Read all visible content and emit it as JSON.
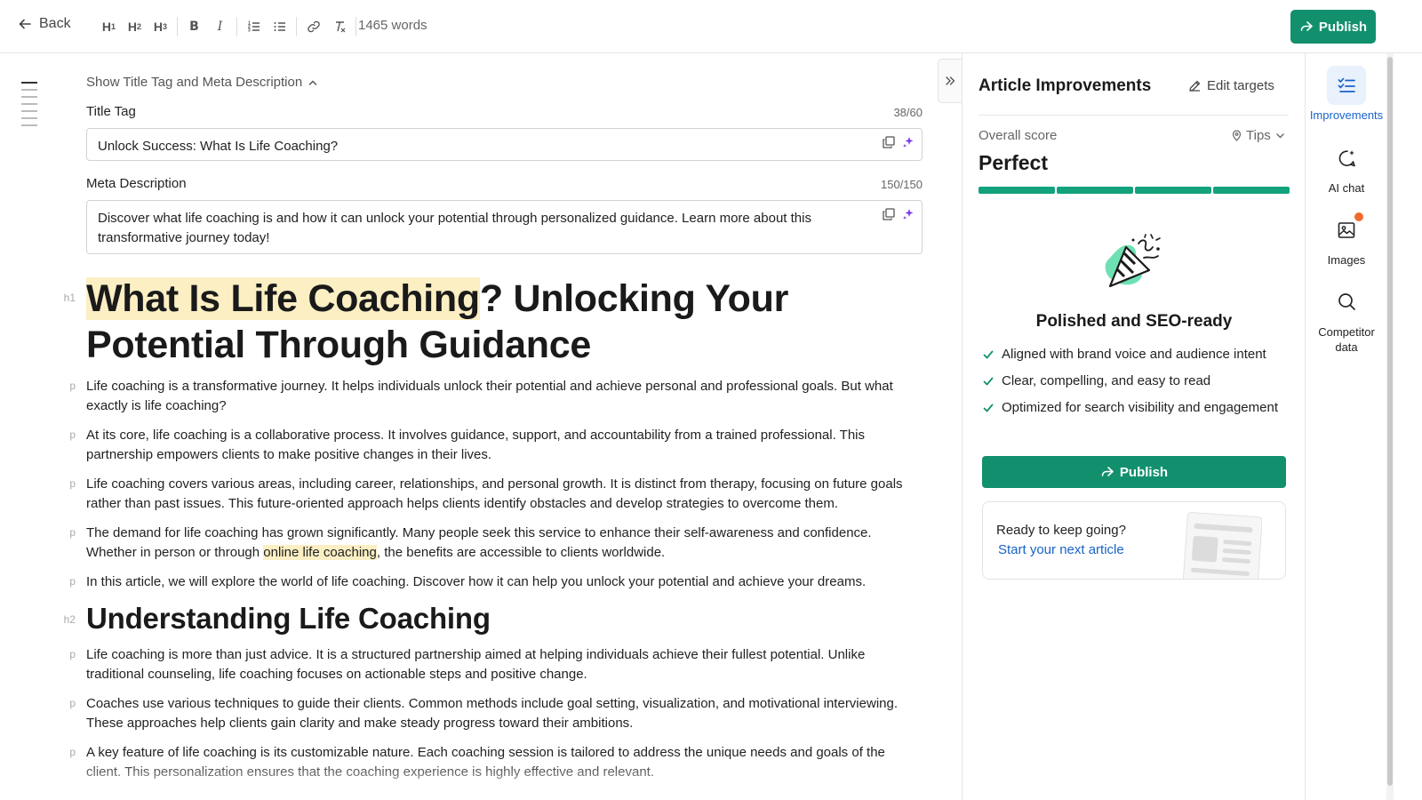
{
  "toolbar": {
    "back_label": "Back",
    "word_count": "1465 words",
    "publish_label": "Publish",
    "tools": [
      "H1",
      "H2",
      "H3",
      "bold",
      "italic",
      "ordered-list",
      "bullet-list",
      "link",
      "clear-format"
    ]
  },
  "meta": {
    "toggle_label": "Show Title Tag and Meta Description",
    "title_label": "Title Tag",
    "title_count": "38/60",
    "title_value": "Unlock Success: What Is Life Coaching?",
    "desc_label": "Meta Description",
    "desc_count": "150/150",
    "desc_value": "Discover what life coaching is and how it can unlock your potential through personalized guidance. Learn more about this transformative journey today!"
  },
  "article": {
    "h1_highlight": "What Is Life Coaching",
    "h1_rest": "? Unlocking Your Potential Through Guidance",
    "p1": "Life coaching is a transformative journey. It helps individuals unlock their potential and achieve personal and professional goals. But what exactly is life coaching?",
    "p2": "At its core, life coaching is a collaborative process. It involves guidance, support, and accountability from a trained professional. This partnership empowers clients to make positive changes in their lives.",
    "p3": "Life coaching covers various areas, including career, relationships, and personal growth. It is distinct from therapy, focusing on future goals rather than past issues. This future-oriented approach helps clients identify obstacles and develop strategies to overcome them.",
    "p4_before": "The demand for life coaching has grown significantly. Many people seek this service to enhance their self-awareness and confidence. Whether in person or through ",
    "p4_highlight": "online life coaching",
    "p4_after": ", the benefits are accessible to clients worldwide.",
    "p5": "In this article, we will explore the world of life coaching. Discover how it can help you unlock your potential and achieve your dreams.",
    "h2": "Understanding Life Coaching",
    "p6": "Life coaching is more than just advice. It is a structured partnership aimed at helping individuals achieve their fullest potential. Unlike traditional counseling, life coaching focuses on actionable steps and positive change.",
    "p7": "Coaches use various techniques to guide their clients. Common methods include goal setting, visualization, and motivational interviewing. These approaches help clients gain clarity and make steady progress toward their ambitions.",
    "p8": "A key feature of life coaching is its customizable nature. Each coaching session is tailored to address the unique needs and goals of the client. This personalization ensures that the coaching experience is highly effective and relevant.",
    "tag_h1": "h1",
    "tag_h2": "h2",
    "tag_p": "p"
  },
  "panel": {
    "title": "Article Improvements",
    "edit_targets": "Edit targets",
    "score_label": "Overall score",
    "tips_label": "Tips",
    "score_value": "Perfect",
    "score_segments_filled": 4,
    "score_segments_total": 4,
    "result_title": "Polished and SEO-ready",
    "checks": [
      "Aligned with brand voice and audience intent",
      "Clear, compelling, and easy to read",
      "Optimized for search visibility and engagement"
    ],
    "publish_label": "Publish",
    "next_title": "Ready to keep going?",
    "next_link": "Start your next article"
  },
  "rail": {
    "improvements": "Improvements",
    "ai_chat": "AI chat",
    "images": "Images",
    "competitor": "Competitor data"
  },
  "colors": {
    "brand_green": "#12906e",
    "highlight": "#fcefc4",
    "link_blue": "#1a63c9",
    "notification": "#f26b2c"
  }
}
